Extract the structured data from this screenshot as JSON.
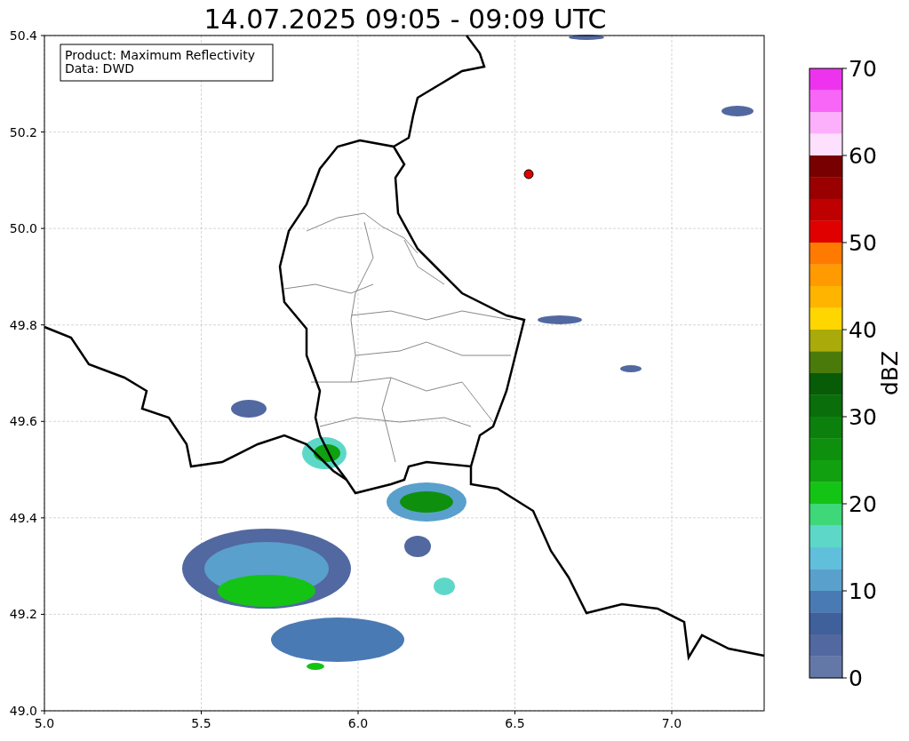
{
  "title": "14.07.2025 09:05 - 09:09 UTC",
  "map": {
    "info_box": [
      "Product: Maximum Reflectivity",
      "Data: DWD"
    ],
    "x_ticks": [
      "5.0",
      "5.5",
      "6.0",
      "6.5",
      "7.0"
    ],
    "y_ticks": [
      "50.4",
      "50.2",
      "50.0",
      "49.8",
      "49.6",
      "49.4",
      "49.2",
      "49.0"
    ]
  },
  "colorbar": {
    "label": "dBZ",
    "ticks": [
      "70",
      "60",
      "50",
      "40",
      "30",
      "20",
      "10",
      "0"
    ],
    "steps": [
      {
        "color": "#ee33ee"
      },
      {
        "color": "#f766f7"
      },
      {
        "color": "#fcb0fc"
      },
      {
        "color": "#fde0fd"
      },
      {
        "color": "#780000"
      },
      {
        "color": "#9a0000"
      },
      {
        "color": "#be0000"
      },
      {
        "color": "#e00000"
      },
      {
        "color": "#ff7a00"
      },
      {
        "color": "#ff9a00"
      },
      {
        "color": "#ffb400"
      },
      {
        "color": "#ffd600"
      },
      {
        "color": "#aaaa0a"
      },
      {
        "color": "#4a7a0a"
      },
      {
        "color": "#085c08"
      },
      {
        "color": "#0a6e0a"
      },
      {
        "color": "#0c800c"
      },
      {
        "color": "#0e900e"
      },
      {
        "color": "#10a010"
      },
      {
        "color": "#14c414"
      },
      {
        "color": "#3ed878"
      },
      {
        "color": "#5dd8c8"
      },
      {
        "color": "#60c0dc"
      },
      {
        "color": "#5aa0cc"
      },
      {
        "color": "#4a7ab4"
      },
      {
        "color": "#40609c"
      },
      {
        "color": "#5268a0"
      },
      {
        "color": "#6478a8"
      }
    ]
  }
}
